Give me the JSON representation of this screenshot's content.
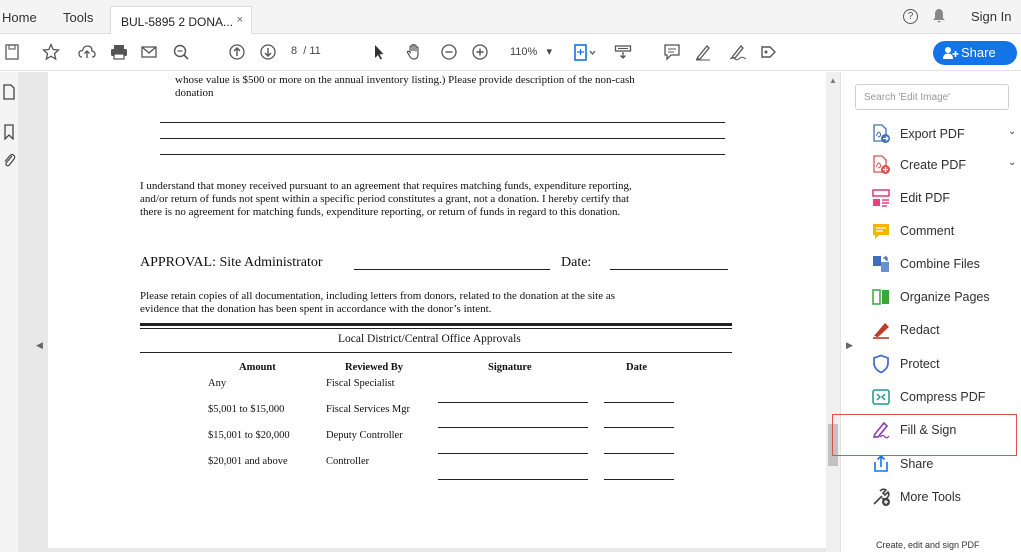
{
  "topbar": {
    "home": "Home",
    "tools": "Tools",
    "doc_tab": "BUL-5895 2 DONA...",
    "close_glyph": "×",
    "help_glyph": "?",
    "sign_in": "Sign In"
  },
  "toolbar": {
    "page_current": "8",
    "page_total": "/ 11",
    "zoom": "110%",
    "zoom_caret": "▾",
    "share_label": "Share"
  },
  "nav": {
    "left_arrow": "◀",
    "right_arrow": "▶",
    "scroll_up": "▲"
  },
  "doc": {
    "para1_line1": "whose value is $500 or more on the annual inventory listing.) Please provide description of the non-cash",
    "para1_line2": "donation",
    "para2_line1": "I understand that money received pursuant to an agreement that requires matching funds, expenditure reporting,",
    "para2_line2": "and/or return of funds not spent within a specific period constitutes a grant, not a donation.  I hereby certify that",
    "para2_line3": "there is no agreement for matching funds, expenditure reporting, or return of funds in regard to this donation.",
    "approval_label": "APPROVAL:  Site Administrator",
    "date_label": "Date:",
    "para3_line1": "Please retain copies of all documentation, including letters from donors, related to the donation at the site as",
    "para3_line2": "evidence that the donation has been spent in accordance with the donor’s intent.",
    "table_title": "Local District/Central Office Approvals",
    "headers": {
      "amount": "Amount",
      "reviewed": "Reviewed By",
      "signature": "Signature",
      "date": "Date"
    },
    "rows": [
      {
        "amount": "Any",
        "reviewed": "Fiscal Specialist"
      },
      {
        "amount": "$5,001 to $15,000",
        "reviewed": "Fiscal Services Mgr"
      },
      {
        "amount": "$15,001 to $20,000",
        "reviewed": "Deputy Controller"
      },
      {
        "amount": "$20,001 and above",
        "reviewed": "Controller"
      }
    ]
  },
  "panel": {
    "search_placeholder": "Search 'Edit Image'",
    "chevron": "⌄",
    "tools": [
      {
        "label": "Export PDF",
        "icon": "export-pdf-icon"
      },
      {
        "label": "Create PDF",
        "icon": "create-pdf-icon"
      },
      {
        "label": "Edit PDF",
        "icon": "edit-pdf-icon"
      },
      {
        "label": "Comment",
        "icon": "comment-icon"
      },
      {
        "label": "Combine Files",
        "icon": "combine-files-icon"
      },
      {
        "label": "Organize Pages",
        "icon": "organize-pages-icon"
      },
      {
        "label": "Redact",
        "icon": "redact-icon"
      },
      {
        "label": "Protect",
        "icon": "protect-icon"
      },
      {
        "label": "Compress PDF",
        "icon": "compress-pdf-icon"
      },
      {
        "label": "Fill & Sign",
        "icon": "fill-sign-icon"
      },
      {
        "label": "Share",
        "icon": "share-icon"
      },
      {
        "label": "More Tools",
        "icon": "more-tools-icon"
      }
    ],
    "footer": "Create, edit and sign PDF"
  },
  "colors": {
    "accent": "#1473e6",
    "highlight": "#d9534f"
  }
}
